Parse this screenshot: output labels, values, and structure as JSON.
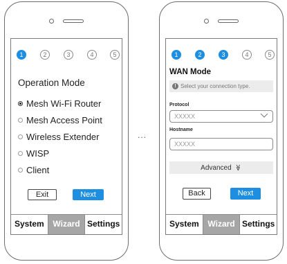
{
  "separator": "...",
  "left_phone": {
    "steps": [
      "1",
      "2",
      "3",
      "4",
      "5"
    ],
    "active_steps": 1,
    "title": "Operation Mode",
    "options": [
      {
        "label": "Mesh Wi-Fi Router",
        "selected": true
      },
      {
        "label": "Mesh Access Point",
        "selected": false
      },
      {
        "label": "Wireless Extender",
        "selected": false
      },
      {
        "label": "WISP",
        "selected": false
      },
      {
        "label": "Client",
        "selected": false
      }
    ],
    "exit_label": "Exit",
    "next_label": "Next",
    "tabs": [
      "System",
      "Wizard",
      "Settings"
    ]
  },
  "right_phone": {
    "steps": [
      "1",
      "2",
      "3",
      "4",
      "5"
    ],
    "active_steps": 3,
    "title": "WAN Mode",
    "hint": "Select your connection type.",
    "protocol_label": "Protocol",
    "protocol_value": "XXXXX",
    "hostname_label": "Hostname",
    "hostname_value": "XXXXX",
    "advanced_label": "Advanced",
    "advanced_icon": "≫",
    "back_label": "Back",
    "next_label": "Next",
    "tabs": [
      "System",
      "Wizard",
      "Settings"
    ]
  },
  "colors": {
    "accent": "#1e8fe0",
    "tab_active": "#a6a6a6"
  }
}
